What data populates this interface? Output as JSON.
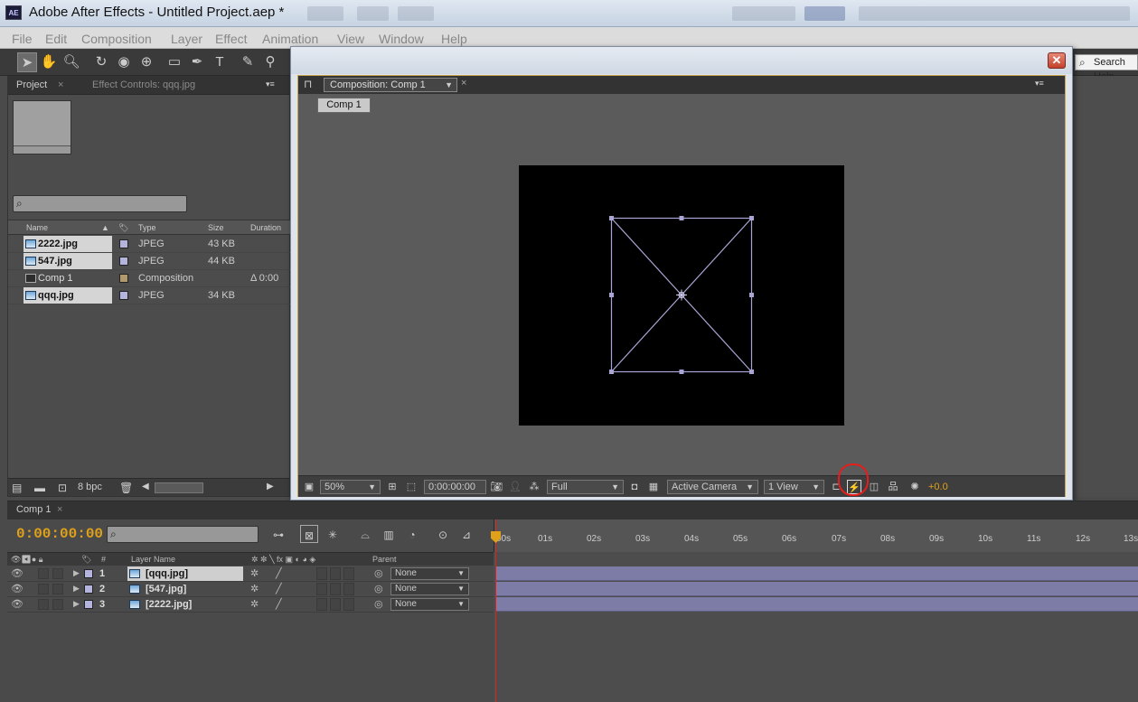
{
  "window": {
    "title": "Adobe After Effects - Untitled Project.aep *",
    "app_badge": "AE"
  },
  "menu": [
    "File",
    "Edit",
    "Composition",
    "Layer",
    "Effect",
    "Animation",
    "View",
    "Window",
    "Help"
  ],
  "search_help": {
    "placeholder": "Search Help"
  },
  "project_panel": {
    "tabs": [
      "Project",
      "Effect Controls: qqq.jpg"
    ],
    "columns": [
      "Name",
      "Type",
      "Size",
      "Duration"
    ],
    "items": [
      {
        "name": "2222.jpg",
        "type": "JPEG",
        "size": "43 KB",
        "duration": "",
        "label_color": "#b4b4dc",
        "kind": "image"
      },
      {
        "name": "547.jpg",
        "type": "JPEG",
        "size": "44 KB",
        "duration": "",
        "label_color": "#b4b4dc",
        "kind": "image"
      },
      {
        "name": "Comp 1",
        "type": "Composition",
        "size": "",
        "duration": "Δ 0:00",
        "label_color": "#b39a6e",
        "kind": "comp"
      },
      {
        "name": "qqq.jpg",
        "type": "JPEG",
        "size": "34 KB",
        "duration": "",
        "label_color": "#b4b4dc",
        "kind": "image"
      }
    ],
    "footer": {
      "bpc": "8 bpc"
    }
  },
  "composition_panel": {
    "tab": "Composition: Comp 1",
    "breadcrumb": "Comp 1",
    "viewer": {
      "magnification": "50%",
      "timecode": "0:00:00:00",
      "resolution": "Full",
      "camera": "Active Camera",
      "views": "1 View",
      "exposure": "+0.0"
    }
  },
  "timeline": {
    "tab": "Comp 1",
    "timecode": "0:00:00:00",
    "columns": [
      "#",
      "Layer Name",
      "Parent"
    ],
    "ruler": [
      "00s",
      "01s",
      "02s",
      "03s",
      "04s",
      "05s",
      "06s",
      "07s",
      "08s",
      "09s",
      "10s",
      "11s",
      "12s",
      "13s"
    ],
    "layers": [
      {
        "num": "1",
        "name": "[qqq.jpg]",
        "parent": "None",
        "selected": true
      },
      {
        "num": "2",
        "name": "[547.jpg]",
        "parent": "None",
        "selected": false
      },
      {
        "num": "3",
        "name": "[2222.jpg]",
        "parent": "None",
        "selected": false
      }
    ]
  },
  "colors": {
    "timecode": "#e0a11a",
    "highlight_circle": "#e51d1d",
    "layer_bar": "#7d7ca6",
    "panel_border_active": "#c8a24a"
  }
}
